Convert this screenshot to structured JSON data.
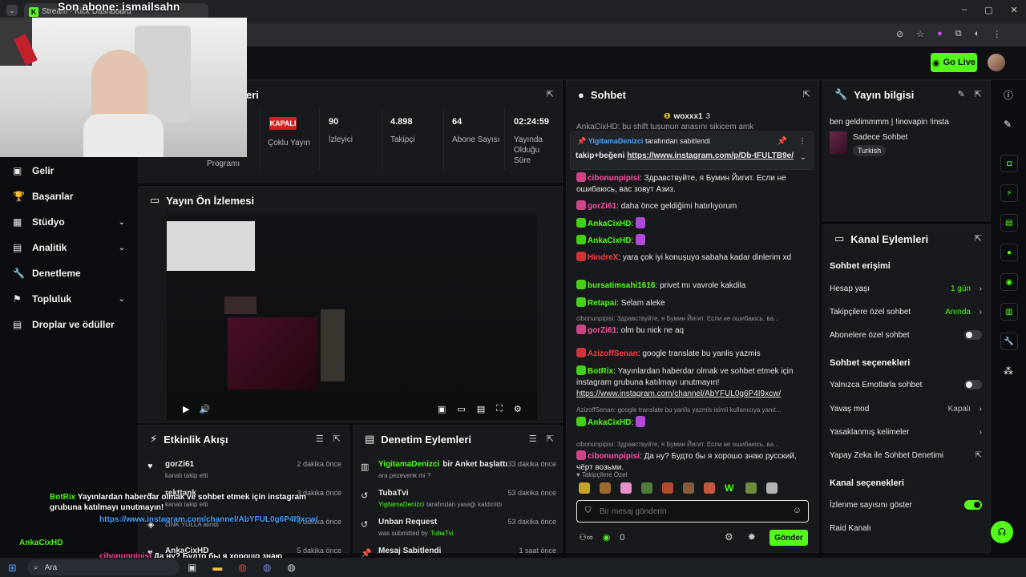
{
  "browser": {
    "tab_title": "Stream - Kick Dashboard"
  },
  "topbar": {
    "go_live": "Go Live"
  },
  "overlay": {
    "title": "Son abone: ismailsahn",
    "chat": [
      {
        "user": "BotRix",
        "text": "Yayınlardan haberdar olmak ve sohbet etmek için instagram grubuna katılmayı unutmayın!",
        "link": "https://www.instagram.com/channel/AbYFUL0g6P4I9xcw/"
      },
      {
        "user": "AnkaCixHD",
        "text": ""
      },
      {
        "user": "cibonunpipisi",
        "text": "Да ну? Будто бы я хорошо знаю русский, чёрт возьми."
      }
    ]
  },
  "nav": {
    "items": [
      {
        "label": "Gelir",
        "icon": "wallet-icon",
        "chev": false
      },
      {
        "label": "Başarılar",
        "icon": "trophy-icon",
        "chev": false
      },
      {
        "label": "Stüdyo",
        "icon": "studio-icon",
        "chev": true
      },
      {
        "label": "Analitik",
        "icon": "analytics-icon",
        "chev": true
      },
      {
        "label": "Denetleme",
        "icon": "wrench-icon",
        "chev": false
      },
      {
        "label": "Topluluk",
        "icon": "community-icon",
        "chev": true
      },
      {
        "label": "Droplar ve ödüller",
        "icon": "drops-icon",
        "chev": false
      }
    ]
  },
  "stream_panel": {
    "title_partial": "eri",
    "program_label": "Programı",
    "status_badge": "KAPALI",
    "status_label": "Çoklu Yayın",
    "stats": [
      {
        "value": "90",
        "label": "İzleyici"
      },
      {
        "value": "4.898",
        "label": "Takipçi"
      },
      {
        "value": "64",
        "label": "Abone Sayısı"
      },
      {
        "value": "02:24:59",
        "label": "Yayında Olduğu Süre"
      }
    ]
  },
  "preview": {
    "title": "Yayın Ön İzlemesi"
  },
  "activity": {
    "title": "Etkinlik Akışı",
    "items": [
      {
        "name": "gorZi61",
        "sub": "kanalı takip etti",
        "time": "2 dakika önce"
      },
      {
        "name": "rekttank",
        "sub": "kanalı takip etti",
        "time": "3 dakika önce"
      },
      {
        "name": "",
        "sub": "LINK YOLLA alındı",
        "time": "4 dakika önce"
      },
      {
        "name": "AnkaCixHD",
        "sub": "",
        "time": "5 dakika önce"
      }
    ]
  },
  "moderation": {
    "title": "Denetim Eylemleri",
    "items": [
      {
        "title": "YigitamaDenizci",
        "action": "bir Anket başlattı",
        "sub": "ara pezevenk mi ?",
        "time": "33 dakika önce"
      },
      {
        "title": "TubaTvi",
        "action": "",
        "sub_user": "YigitamaDenizci",
        "sub": "tarafından yasağı kaldırıldı",
        "time": "53 dakika önce"
      },
      {
        "title": "Unban Request",
        "action": "",
        "sub": "was submitted by",
        "sub_user": "TubaTvi",
        "time": "53 dakika önce"
      },
      {
        "title": "Mesaj Sabitlendi",
        "action": "",
        "sub": "",
        "time": "1 saat önce"
      }
    ]
  },
  "chat": {
    "title": "Sohbet",
    "top_gifter": "woxxx1",
    "top_gifter_count": "3",
    "partial_first": "AnkaCixHD: bu shift tuşunun anasını sikicem amk",
    "pinned": {
      "by_user": "YigitamaDenizci",
      "by_text": "tarafından sabitlendi",
      "text": "takip+beğeni",
      "link": "https://www.instagram.com/p/Db-tFULTB9e/"
    },
    "messages": [
      {
        "user": "cibonunpipisi",
        "color": "#ff4fa3",
        "text": "Здравствуйте, я Бумин Йигит. Если не ошибаюсь, вас зовут Азиз."
      },
      {
        "user": "gorZi61",
        "color": "#ff4fa3",
        "text": "daha önce geldiğimi hatırlıyorum"
      },
      {
        "user": "AnkaCixHD",
        "color": "#53fc18",
        "text": ""
      },
      {
        "user": "AnkaCixHD",
        "color": "#53fc18",
        "text": ""
      },
      {
        "user": "HindreX",
        "color": "#ff3c3c",
        "text": "yara çok iyi konuşuyo sabaha kadar dinlerim xd"
      },
      {
        "user": "bursatimsahi1616",
        "color": "#53fc18",
        "text": "privet mı vavrole kakdila"
      },
      {
        "user": "Retapai",
        "color": "#53fc18",
        "text": "Selam aleke"
      },
      {
        "reply": "cibonunpipisi: Здравствуйте, я Бумин Йигит. Если не ошибаюсь, ва...",
        "user": "gorZi61",
        "color": "#ff4fa3",
        "text": "olm bu nick ne aq"
      },
      {
        "user": "AzizoffSenan",
        "color": "#ff3c3c",
        "text": "google translate bu yanlis yazmis"
      },
      {
        "user": "BotRix",
        "color": "#53fc18",
        "text": "Yayınlardan haberdar olmak ve sohbet etmek için instagram grubuna katılmayı unutmayın!",
        "link": "https://www.instagram.com/channel/AbYFUL0g6P4I9xcw/"
      },
      {
        "reply": "AzizoffSenan: google translate bu yanlis yazmis isimli kullanıcıya yanıt...",
        "user": "AnkaCixHD",
        "color": "#53fc18",
        "text": ""
      },
      {
        "reply": "cibonunpipisi: Здравствуйте, я Бумин Йигит. Если не ошибаюсь, ва...",
        "user": "cibonunpipisi",
        "color": "#ff4fa3",
        "text": "Да ну? Будто бы я хорошо знаю русский, чёрт возьми."
      }
    ],
    "followers_only": "Takipçilere Özel",
    "input_placeholder": "Bir mesaj gönderin",
    "points": "0",
    "send": "Gönder"
  },
  "stream_info": {
    "title": "Yayın bilgisi",
    "stream_title": "ben geldimmmm | !inovapin !insta",
    "category": "Sadece Sohbet",
    "tag": "Turkish"
  },
  "channel_actions": {
    "title": "Kanal Eylemleri",
    "chat_access_title": "Sohbet erişimi",
    "chat_access": [
      {
        "label": "Hesap yaşı",
        "value": "1 gün",
        "type": "chevron"
      },
      {
        "label": "Takipçilere özel sohbet",
        "value": "Anında",
        "type": "chevron"
      },
      {
        "label": "Abonelere özel sohbet",
        "type": "toggle",
        "on": false
      }
    ],
    "chat_options_title": "Sohbet seçenekleri",
    "chat_options": [
      {
        "label": "Yalnızca Emotlarla sohbet",
        "type": "toggle",
        "on": false
      },
      {
        "label": "Yavaş mod",
        "value": "Kapalı",
        "type": "chevron"
      },
      {
        "label": "Yasaklanmış kelimeler",
        "type": "chevron"
      },
      {
        "label": "Yapay Zeka ile Sohbet Denetimi",
        "type": "external"
      }
    ],
    "channel_options_title": "Kanal seçenekleri",
    "channel_options": [
      {
        "label": "İzlenme sayısını göster",
        "type": "toggle",
        "on": true
      },
      {
        "label": "Raid Kanalı",
        "type": "none"
      }
    ]
  },
  "taskbar": {
    "search": "Ara"
  }
}
